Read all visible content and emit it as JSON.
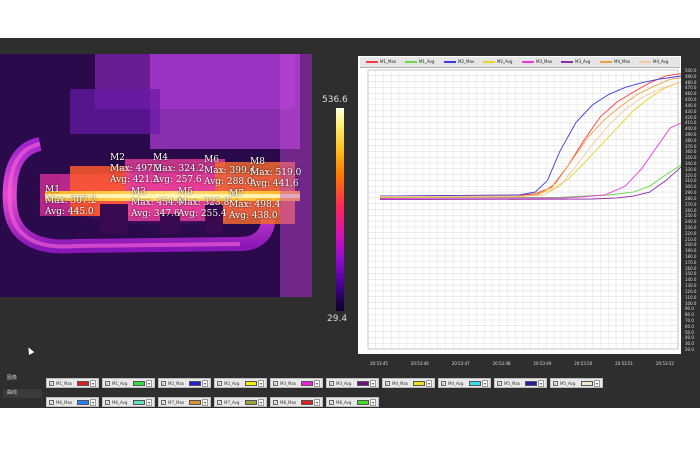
{
  "thermal": {
    "scale_max": "536.6",
    "scale_min": "29.4",
    "markers": [
      {
        "name": "M1",
        "max": "Max: 507.2",
        "avg": "Avg: 445.0"
      },
      {
        "name": "M2",
        "max": "Max: 497.2",
        "avg": "Avg: 421.2"
      },
      {
        "name": "M3",
        "max": "Max: 454.4",
        "avg": "Avg: 347.6"
      },
      {
        "name": "M4",
        "max": "Max: 324.2",
        "avg": "Avg: 257.6"
      },
      {
        "name": "M5",
        "max": "Max: 323.8",
        "avg": "Avg: 255.4"
      },
      {
        "name": "M6",
        "max": "Max: 399.4",
        "avg": "Avg: 288.0"
      },
      {
        "name": "M7",
        "max": "Max: 498.4",
        "avg": "Avg: 438.0"
      },
      {
        "name": "M8",
        "max": "Max: 519.0",
        "avg": "Avg: 441.6"
      }
    ]
  },
  "sidebar": {
    "tabs": [
      "图像",
      "曲线"
    ]
  },
  "chart_data": {
    "type": "line",
    "legend": [
      "M1_Max",
      "M1_Avg",
      "M2_Max",
      "M2_Avg",
      "M3_Max",
      "M3_Avg",
      "M4_Max",
      "M4_Avg"
    ],
    "y_ticks": [
      "500.0",
      "490.0",
      "480.0",
      "470.0",
      "460.0",
      "450.0",
      "440.0",
      "430.0",
      "420.0",
      "410.0",
      "400.0",
      "390.0",
      "380.0",
      "370.0",
      "360.0",
      "350.0",
      "340.0",
      "330.0",
      "320.0",
      "310.0",
      "300.0",
      "290.0",
      "280.0",
      "270.0",
      "260.0",
      "250.0",
      "240.0",
      "230.0",
      "220.0",
      "210.0",
      "200.0",
      "190.0",
      "180.0",
      "170.0",
      "160.0",
      "150.0",
      "140.0",
      "130.0",
      "120.0",
      "110.0",
      "100.0",
      "90.0",
      "80.0",
      "70.0",
      "60.0",
      "50.0",
      "40.0",
      "30.0",
      "20.0"
    ],
    "x_ticks": [
      "20:53:45",
      "20:53:46",
      "20:53:47",
      "20:53:48",
      "20:53:49",
      "20:53:50",
      "20:53:51",
      "20:53:52"
    ],
    "ylim": [
      20,
      500
    ],
    "series": [
      {
        "name": "M1_Max",
        "color": "#ff3a3a",
        "x": [
          0,
          3.5,
          3.8,
          4.2,
          4.6,
          5.0,
          5.4,
          5.8,
          6.2,
          6.6,
          7.0,
          7.4
        ],
        "values": [
          283,
          285,
          287,
          298,
          335,
          380,
          420,
          445,
          462,
          478,
          490,
          494
        ]
      },
      {
        "name": "M1_Avg",
        "color": "#6ad84a",
        "x": [
          0,
          4.4,
          5.0,
          5.6,
          6.2,
          6.6,
          7.0,
          7.4
        ],
        "values": [
          280,
          281,
          283,
          285,
          290,
          300,
          320,
          338
        ]
      },
      {
        "name": "M2_Max",
        "color": "#3a3ae0",
        "x": [
          0,
          3.4,
          3.8,
          4.1,
          4.4,
          4.8,
          5.2,
          5.6,
          6.0,
          6.4,
          6.8,
          7.2,
          7.4
        ],
        "values": [
          283,
          285,
          290,
          310,
          360,
          410,
          440,
          458,
          470,
          478,
          484,
          488,
          490
        ]
      },
      {
        "name": "M2_Avg",
        "color": "#e8d12a",
        "x": [
          0,
          3.5,
          3.8,
          4.2,
          4.6,
          5.0,
          5.4,
          5.8,
          6.2,
          6.6,
          7.0,
          7.4
        ],
        "values": [
          281,
          282,
          286,
          294,
          312,
          340,
          370,
          400,
          430,
          452,
          470,
          480
        ]
      },
      {
        "name": "M3_Max",
        "color": "#e73ae0",
        "x": [
          0,
          4.5,
          5.0,
          5.5,
          6.0,
          6.4,
          6.8,
          7.1,
          7.4
        ],
        "values": [
          279,
          280,
          282,
          285,
          300,
          330,
          370,
          400,
          410
        ]
      },
      {
        "name": "M3_Avg",
        "color": "#8a2aa0",
        "x": [
          0,
          5.2,
          5.8,
          6.2,
          6.6,
          7.0,
          7.4
        ],
        "values": [
          277,
          278,
          280,
          283,
          290,
          310,
          335
        ]
      },
      {
        "name": "M4_Max",
        "color": "#f0a040",
        "x": [
          0,
          3.5,
          3.9,
          4.3,
          4.7,
          5.1,
          5.5,
          5.9,
          6.3,
          6.7,
          7.1,
          7.4
        ],
        "values": [
          282,
          283,
          286,
          305,
          345,
          385,
          415,
          438,
          458,
          472,
          484,
          487
        ]
      },
      {
        "name": "M4_Avg",
        "color": "#f5c8a0",
        "x": [
          0,
          3.6,
          4.0,
          4.4,
          4.8,
          5.2,
          5.6,
          6.0,
          6.4,
          6.8,
          7.2,
          7.4
        ],
        "values": [
          282,
          283,
          285,
          300,
          335,
          372,
          405,
          432,
          452,
          466,
          476,
          480
        ]
      }
    ]
  },
  "channels": [
    {
      "name": "M1_Max",
      "color": "#e02020"
    },
    {
      "name": "M1_Avg",
      "color": "#30e040"
    },
    {
      "name": "M2_Max",
      "color": "#2020d0"
    },
    {
      "name": "M2_Avg",
      "color": "#f0f000"
    },
    {
      "name": "M3_Max",
      "color": "#f020e0"
    },
    {
      "name": "M3_Avg",
      "color": "#701080"
    },
    {
      "name": "M4_Max",
      "color": "#f0e020"
    },
    {
      "name": "M4_Avg",
      "color": "#30e0f0"
    },
    {
      "name": "M5_Max",
      "color": "#2020a0"
    },
    {
      "name": "M5_Avg",
      "color": "#f5ead0"
    },
    {
      "name": "M6_Max",
      "color": "#2080ff"
    },
    {
      "name": "M6_Avg",
      "color": "#60e0c0"
    },
    {
      "name": "M7_Max",
      "color": "#e09030"
    },
    {
      "name": "M7_Avg",
      "color": "#a0a040"
    },
    {
      "name": "M8_Max",
      "color": "#e02020"
    },
    {
      "name": "M8_Avg",
      "color": "#40e020"
    }
  ]
}
